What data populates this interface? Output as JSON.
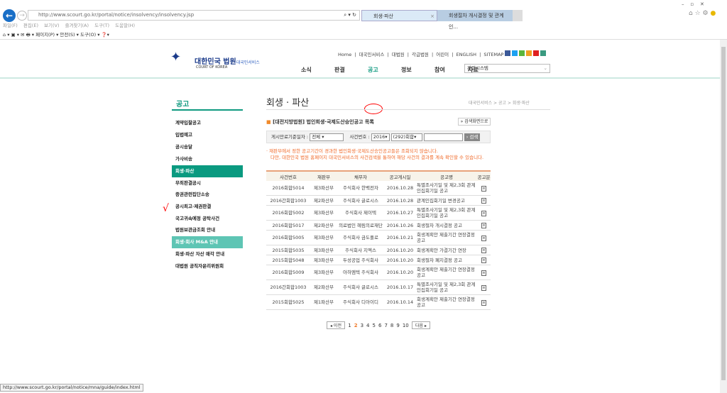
{
  "browser": {
    "url": "http://www.scourt.go.kr/portal/notice/insolvency/insolvency.jsp",
    "tabs": [
      {
        "label": "회생·파산"
      },
      {
        "label": "회생절차 개시결정 및 관계인..."
      }
    ],
    "menu": "파일(F) 편집(E) 보기(V) 즐겨찾기(A) 도구(T) 도움말(H)",
    "toolbar": "페이지(P) ▾  안전(S) ▾  도구(O) ▾",
    "status_url": "http://www.scourt.go.kr/portal/notice/mna/guide/index.html"
  },
  "header": {
    "logo": "대한민국 법원",
    "logo_sub": "대국민서비스",
    "logo_en": "COURT OF KOREA",
    "toplinks": "Home | 대국민서비스 | 대법원 | 각급법원 | 어린이 | ENGLISH | SITEMAP",
    "nav": [
      "소식",
      "판결",
      "공고",
      "정보",
      "참여",
      "자료"
    ],
    "related_select": "관련시스템"
  },
  "sidebar": {
    "title": "공고",
    "items": [
      "계약입찰공고",
      "입법예고",
      "공시송달",
      "가사비송",
      "회생·파산",
      "무죄판결공시",
      "증권관련집단소송",
      "공시최고·제권판결",
      "국고귀속예정 공탁사건",
      "법원보관금조회 안내",
      "회생·회사 M&A 안내",
      "회생·파산 자산 매각 안내",
      "대법원 공직자윤리위원회"
    ],
    "active": "회생·파산"
  },
  "main": {
    "title": "회생 · 파산",
    "breadcrumb": "대국민서비스 > 공고 > 회생·파산",
    "section": "[대전지방법원] 법인회생·국제도산승인공고 목록",
    "search_screen_btn": "» 검색화면으로",
    "search": {
      "date_label": "게시만료기준일자 :",
      "date_value": "전체",
      "case_label": "사건번호 :",
      "year": "2016",
      "type": "(292)회합",
      "button": "› 검색"
    },
    "notice": [
      "· 재판부에서 정한 공고기간이 경과한 법인회생·국제도산승인공고들은 조회되지 않습니다.",
      "다만, 대한민국 법원 홈페이지 대국민서비스의 사건검색을 통하여 해당 사건의 결과를 계속 확인할 수 있습니다."
    ]
  },
  "table": {
    "headers": [
      "사건번호",
      "재판부",
      "채무자",
      "공고게시일",
      "공고명",
      "공고문"
    ],
    "rows": [
      [
        "2016회합5014",
        "제3파산부",
        "주식회사 한백전자",
        "2016.10.28",
        "특별조사기일 및 제2,3회 관계인집회기일 공고"
      ],
      [
        "2016간회합1003",
        "제2파산부",
        "주식회사 글로시스",
        "2016.10.28",
        "관계인집회기일 변경공고"
      ],
      [
        "2016회합5002",
        "제3파산부",
        "주식회사 제이텍",
        "2016.10.27",
        "특별조사기일 및 제2,3회 관계인집회기일 공고"
      ],
      [
        "2016회합5017",
        "제2파산부",
        "의료법인 혜림의료재단",
        "2016.10.26",
        "회생절차 개시결정 공고"
      ],
      [
        "2016회합5005",
        "제3파산부",
        "주식회사 금도폴로",
        "2016.10.21",
        "회생계획안 제출기간 연장결정 공고"
      ],
      [
        "2015회합5035",
        "제3파산부",
        "주식회사 지엑스",
        "2016.10.20",
        "회생계획안 가결기간 연장"
      ],
      [
        "2015회합5048",
        "제3파산부",
        "두성공업 주식회사",
        "2016.10.20",
        "회생절차 폐지결정 공고"
      ],
      [
        "2016회합5009",
        "제3파산부",
        "아하엠텍 주식회사",
        "2016.10.20",
        "회생계획안 제출기간 연장결정 공고"
      ],
      [
        "2016간회합1003",
        "제2파산부",
        "주식회사 글로시스",
        "2016.10.17",
        "특별조사기일 및 제2,3회 관계인집회기일 공고"
      ],
      [
        "2015회합5025",
        "제1파산부",
        "주식회사 디아이디",
        "2016.10.14",
        "회생계획안 제출기간 연장결정 공고"
      ]
    ]
  },
  "pagination": {
    "prev": "◂ 이전",
    "pages": [
      "1",
      "2",
      "3",
      "4",
      "5",
      "6",
      "7",
      "8",
      "9",
      "10"
    ],
    "current": "2",
    "next": "다음 ▸"
  }
}
